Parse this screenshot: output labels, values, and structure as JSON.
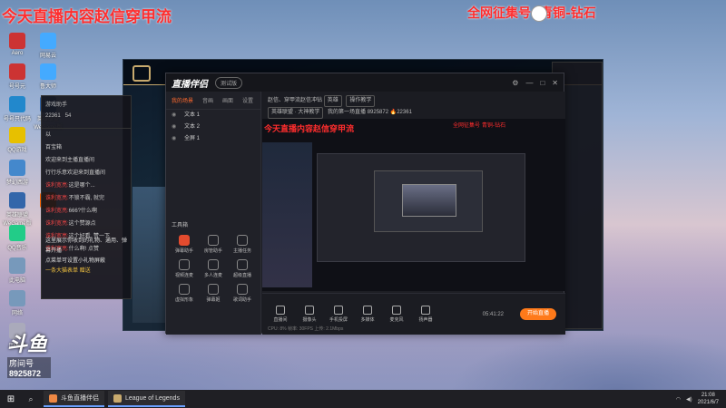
{
  "overlay": {
    "left_banner": "今天直播内容赵信穿甲流",
    "right_banner_1": "全网征集号",
    "right_banner_2": "青铜-钻石"
  },
  "desktop_icons": [
    {
      "label": "Aero"
    },
    {
      "label": "网易云"
    },
    {
      "label": "号号元"
    },
    {
      "label": "鲁大师"
    },
    {
      "label": "号号只代码"
    },
    {
      "label": "英雄联盟WeGame版"
    },
    {
      "label": "QQ游戏"
    },
    {
      "label": "梦幻西游"
    },
    {
      "label": "英雄联盟WeGame版"
    },
    {
      "label": "斗鱼"
    },
    {
      "label": "QQ音乐"
    },
    {
      "label": "此电脑"
    },
    {
      "label": "网络"
    },
    {
      "label": "回收站"
    }
  ],
  "chat": {
    "header_user": "游戏助手",
    "header_count": "22361",
    "header_num2": "54",
    "lines": [
      {
        "user": "",
        "text": "以"
      },
      {
        "user": "",
        "text": "百宝箱"
      },
      {
        "user": "",
        "text": "欢迎来到主播直播间"
      },
      {
        "user": "",
        "text": "行行乐意欢迎来到直播间"
      },
      {
        "user": "诛利宽亮:",
        "text": "这是哪个..."
      },
      {
        "user": "诛利宽亮:",
        "text": "不锁不霸, 就完"
      },
      {
        "user": "诛利宽亮:",
        "text": "666?什么啊"
      },
      {
        "user": "诛利宽亮:",
        "text": "这个赞源点"
      },
      {
        "user": "诛利宽亮:",
        "text": "这个好看, 赞一下"
      },
      {
        "user": "诛利宽亮:",
        "text": "什么啊! 点赞"
      }
    ],
    "footer_1": "这里展示你收到的礼物、通用、弹幕开播",
    "footer_2": "点菜单可设置小礼物屏蔽",
    "footer_3": "一条大猫表单 赠送"
  },
  "obs": {
    "title": "直播伴侣",
    "badge": "测试版",
    "tabs": [
      "我的场景",
      "音画",
      "画面",
      "设置"
    ],
    "scenes": [
      "文本 1",
      "文本 2",
      "全屏 1"
    ],
    "tools_title": "工具箱",
    "tools": [
      {
        "label": "弹幕助手",
        "hot": true
      },
      {
        "label": "房管助手",
        "hot": false
      },
      {
        "label": "主播任务",
        "hot": false
      },
      {
        "label": "视频连麦",
        "hot": false
      },
      {
        "label": "多人连麦",
        "hot": false
      },
      {
        "label": "超级直播",
        "hot": false
      },
      {
        "label": "虚拟形象",
        "hot": false
      },
      {
        "label": "弹幕姬",
        "hot": false
      },
      {
        "label": "歌词助手",
        "hot": false
      }
    ],
    "info_line_1": "赵信、穿甲流赵信冲钻",
    "info_pill_1": "英雄",
    "info_pill_2": "操作教学",
    "info_line_2": "英雄联盟 · 大神教学",
    "info_line_3": "我的第一场直播",
    "room_id": "8925872",
    "online": "22361",
    "preview_red_a": "今天直播内容赵信穿甲流",
    "preview_red_b": "全网征集号  青铜-钻石",
    "bottom_buttons": [
      "直播间",
      "摄像头",
      "手机投屏",
      "多媒体",
      "麦克风",
      "扬声器"
    ],
    "live_button": "开始直播",
    "duration": "05:41:22",
    "status": "CPU: 8%   帧率: 30FPS   上传: 2.1Mbps"
  },
  "room_badge": {
    "logo": "斗鱼",
    "label": "房间号",
    "number": "8925872"
  },
  "taskbar": {
    "items": [
      {
        "label": "斗鱼直播伴侣",
        "kind": "douyu"
      },
      {
        "label": "League of Legends",
        "kind": "lol"
      }
    ],
    "time": "21:08",
    "date": "2021/6/7"
  }
}
